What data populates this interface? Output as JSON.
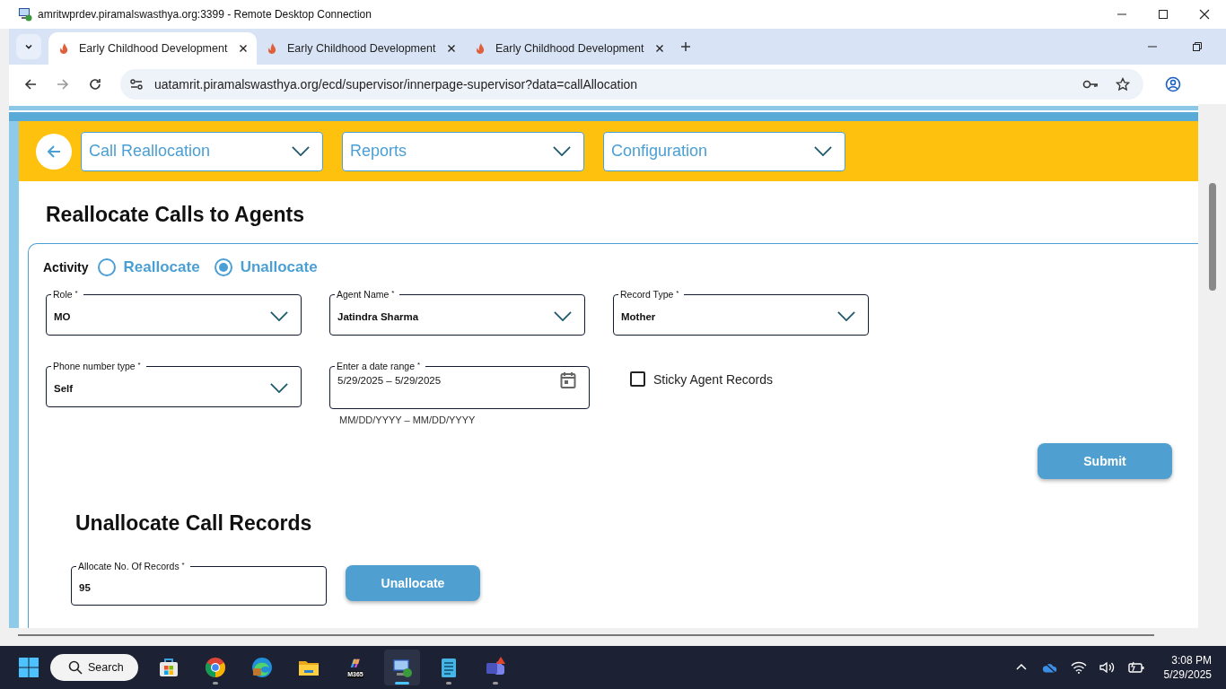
{
  "window": {
    "title": "amritwprdev.piramalswasthya.org:3399 - Remote Desktop Connection"
  },
  "browser_tabs": [
    {
      "label": "Early Childhood Development",
      "selected": true
    },
    {
      "label": "Early Childhood Development",
      "selected": false
    },
    {
      "label": "Early Childhood Development",
      "selected": false
    }
  ],
  "address_bar": {
    "url": "uatamrit.piramalswasthya.org/ecd/supervisor/innerpage-supervisor?data=callAllocation"
  },
  "nav_menus": [
    "Call Reallocation",
    "Reports",
    "Configuration"
  ],
  "page_title": "Reallocate Calls to Agents",
  "activity": {
    "label": "Activity",
    "options": [
      {
        "label": "Reallocate",
        "selected": false
      },
      {
        "label": "Unallocate",
        "selected": true
      }
    ]
  },
  "fields": [
    {
      "kind": "select",
      "label": "Role",
      "required_mark": "*",
      "value": "MO"
    },
    {
      "kind": "select",
      "label": "Agent Name",
      "required_mark": "*",
      "value": "Jatindra Sharma"
    },
    {
      "kind": "select",
      "label": "Record Type",
      "required_mark": "*",
      "value": "Mother"
    },
    {
      "kind": "select",
      "label": "Phone number type",
      "required_mark": "*",
      "value": "Self"
    },
    {
      "kind": "date",
      "label": "Enter a date range",
      "required_mark": "*",
      "value": "5/29/2025",
      "value_end": "5/29/2025",
      "separator": "–",
      "hint": "MM/DD/YYYY – MM/DD/YYYY"
    },
    {
      "kind": "checkbox",
      "label": "Sticky Agent Records",
      "checked": false
    }
  ],
  "submit_button": "Submit",
  "unallocate_section": {
    "title": "Unallocate Call Records",
    "field": {
      "label": "Allocate No. Of Records",
      "required_mark": "*",
      "value": "95"
    },
    "button": "Unallocate"
  },
  "taskbar": {
    "search": "Search",
    "apps": [
      {
        "kind": "store",
        "running": false,
        "selected": false
      },
      {
        "kind": "chrome",
        "running": true,
        "selected": false
      },
      {
        "kind": "edge",
        "running": false,
        "selected": false
      },
      {
        "kind": "folder",
        "running": false,
        "selected": false
      },
      {
        "kind": "m365",
        "label": "M365",
        "running": false,
        "selected": false
      },
      {
        "kind": "rdp",
        "running": true,
        "selected": true
      },
      {
        "kind": "notepad",
        "running": true,
        "selected": false
      },
      {
        "kind": "teams",
        "running": true,
        "selected": false
      }
    ],
    "time": "3:08 PM",
    "date": "5/29/2025"
  }
}
